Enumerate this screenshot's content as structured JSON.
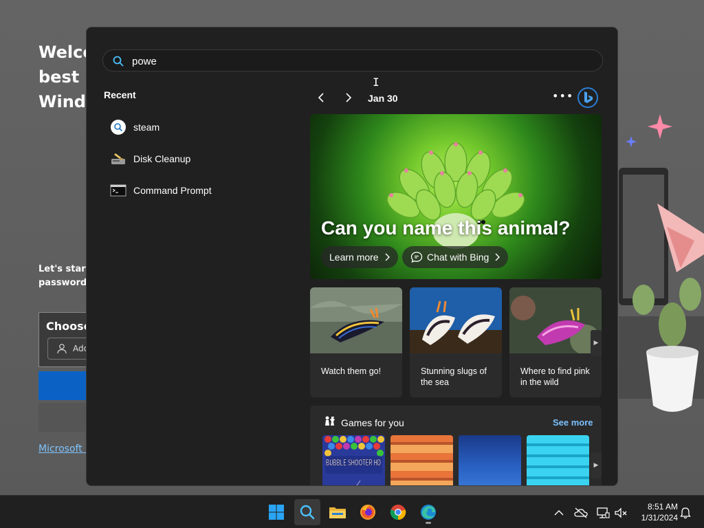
{
  "background": {
    "heading": "Welco\nbest p\nWindo",
    "text": "Let's start b\npasswords,",
    "card_title": "Choose",
    "card_input": "Add",
    "link": "Microsoft P"
  },
  "search": {
    "value": "powe"
  },
  "recent": {
    "title": "Recent",
    "items": [
      {
        "label": "steam",
        "icon": "search-icon"
      },
      {
        "label": "Disk Cleanup",
        "icon": "disk-cleanup-icon"
      },
      {
        "label": "Command Prompt",
        "icon": "command-prompt-icon"
      }
    ]
  },
  "highlights": {
    "date": "Jan 30",
    "more": "•••",
    "hero": {
      "title": "Can you name this animal?",
      "learn_more": "Learn more",
      "chat_with_bing": "Chat with Bing"
    },
    "cards": [
      {
        "caption": "Watch them go!"
      },
      {
        "caption": "Stunning slugs of the sea"
      },
      {
        "caption": "Where to find pink in the wild"
      }
    ],
    "games": {
      "title": "Games for you",
      "see_more": "See more",
      "first_game_label": "BUBBLE SHOOTER HD"
    }
  },
  "taskbar": {
    "time": "8:51 AM",
    "date": "1/31/2024",
    "apps": [
      "start-icon",
      "search-icon",
      "file-explorer-icon",
      "firefox-icon",
      "chrome-icon",
      "edge-icon"
    ]
  },
  "colors": {
    "accent": "#4cc2ff",
    "link": "#7cc0ff",
    "flyout_bg": "#202020",
    "taskbar_bg": "#202020"
  }
}
